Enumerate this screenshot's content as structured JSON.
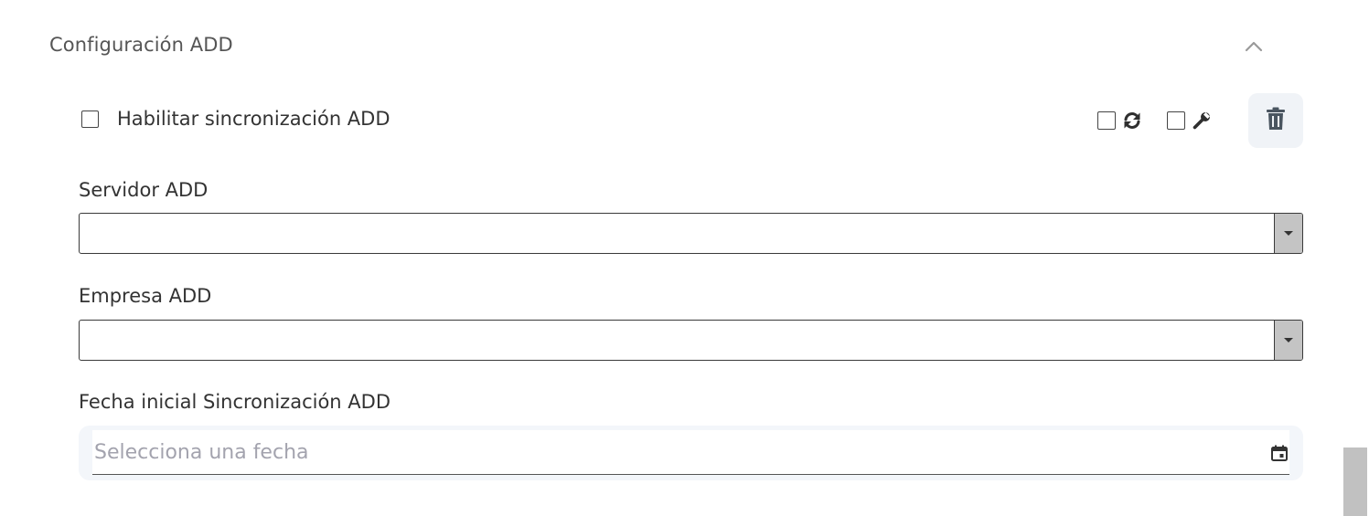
{
  "section": {
    "title": "Configuración ADD",
    "collapse_icon": "chevron-up-icon"
  },
  "enable_sync": {
    "label": "Habilitar sincronización ADD",
    "checked": false
  },
  "tools": {
    "sync_icon": "refresh-icon",
    "sync_checked": false,
    "config_icon": "wrench-icon",
    "config_checked": false,
    "delete_icon": "trash-icon"
  },
  "fields": {
    "server_label": "Servidor ADD",
    "server_value": "",
    "company_label": "Empresa ADD",
    "company_value": "",
    "date_label": "Fecha inicial Sincronización ADD",
    "date_value": "",
    "date_placeholder": "Selecciona una fecha",
    "date_icon": "calendar-icon"
  },
  "colors": {
    "delete_button_bg": "#f0f3f7",
    "select_arrow_bg": "#c4c4c4",
    "placeholder": "#a3a3ae"
  }
}
